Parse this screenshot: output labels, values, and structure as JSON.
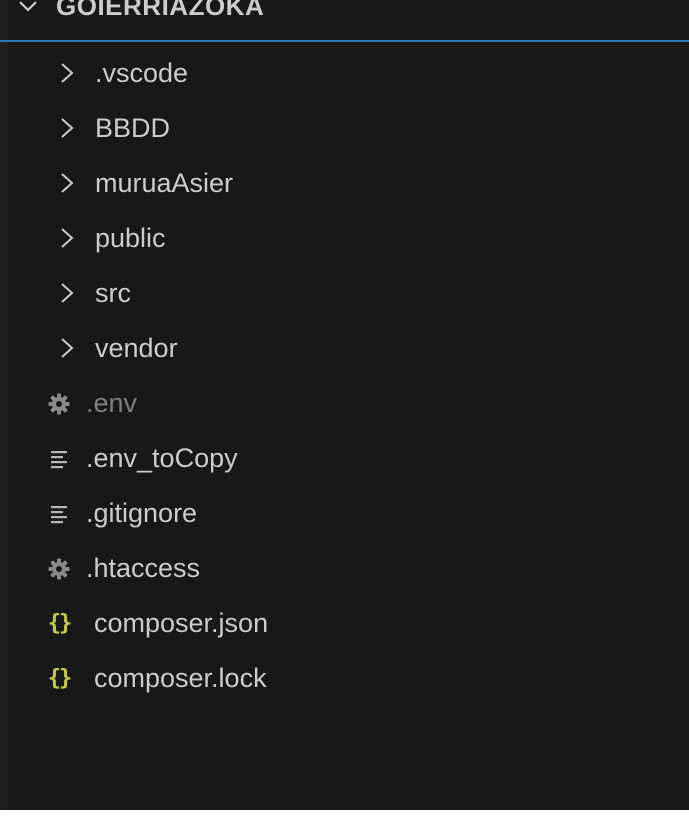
{
  "explorer": {
    "root_label": "GOIERRIAZOKA",
    "root_icon": "chevron-down-icon",
    "accent_color": "#2b79b8",
    "folders": [
      {
        "label": ".vscode",
        "icon": "chevron-right-icon"
      },
      {
        "label": "BBDD",
        "icon": "chevron-right-icon"
      },
      {
        "label": "muruaAsier",
        "icon": "chevron-right-icon"
      },
      {
        "label": "public",
        "icon": "chevron-right-icon"
      },
      {
        "label": "src",
        "icon": "chevron-right-icon"
      },
      {
        "label": "vendor",
        "icon": "chevron-right-icon"
      }
    ],
    "files": [
      {
        "label": ".env",
        "icon": "gear-icon",
        "dimmed": true
      },
      {
        "label": ".env_toCopy",
        "icon": "lines-icon"
      },
      {
        "label": ".gitignore",
        "icon": "lines-icon"
      },
      {
        "label": ".htaccess",
        "icon": "gear-icon"
      },
      {
        "label": "composer.json",
        "icon": "json-braces-icon",
        "icon_color": "#cbcb41"
      },
      {
        "label": "composer.lock",
        "icon": "json-braces-icon",
        "icon_color": "#cbcb41"
      }
    ]
  }
}
